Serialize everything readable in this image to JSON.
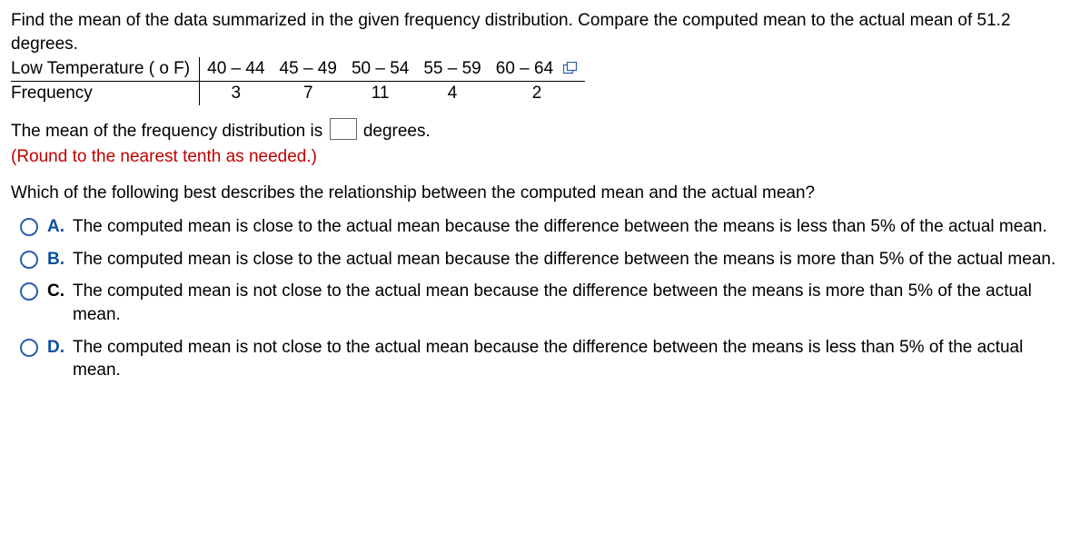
{
  "problem": {
    "intro": "Find the mean of the data summarized in the given frequency distribution. Compare the computed mean to the actual mean of 51.2 degrees.",
    "table": {
      "row1_header": "Low Temperature ( o F)",
      "row2_header": "Frequency",
      "columns": [
        "40 – 44",
        "45 – 49",
        "50 – 54",
        "55 – 59",
        "60 – 64"
      ],
      "frequencies": [
        "3",
        "7",
        "11",
        "4",
        "2"
      ]
    }
  },
  "fill_in": {
    "prefix": "The mean of the frequency distribution is",
    "suffix": "degrees.",
    "instruction": "(Round to the nearest tenth as needed.)"
  },
  "mc": {
    "question": "Which of the following best describes the relationship between the computed mean and the actual mean?",
    "options": {
      "A": {
        "label": "A.",
        "text": "The computed mean is close to the actual mean because the difference between the means is less than 5% of the actual mean."
      },
      "B": {
        "label": "B.",
        "text": "The computed mean is close to the actual mean because the difference between the means is more than 5% of the actual mean."
      },
      "C": {
        "label": "C.",
        "text": "The computed mean is not close to the actual mean because the difference between the means is more than 5% of the actual mean."
      },
      "D": {
        "label": "D.",
        "text": "The computed mean is not close to the actual mean because the difference between the means is less than 5% of the actual mean."
      }
    }
  }
}
